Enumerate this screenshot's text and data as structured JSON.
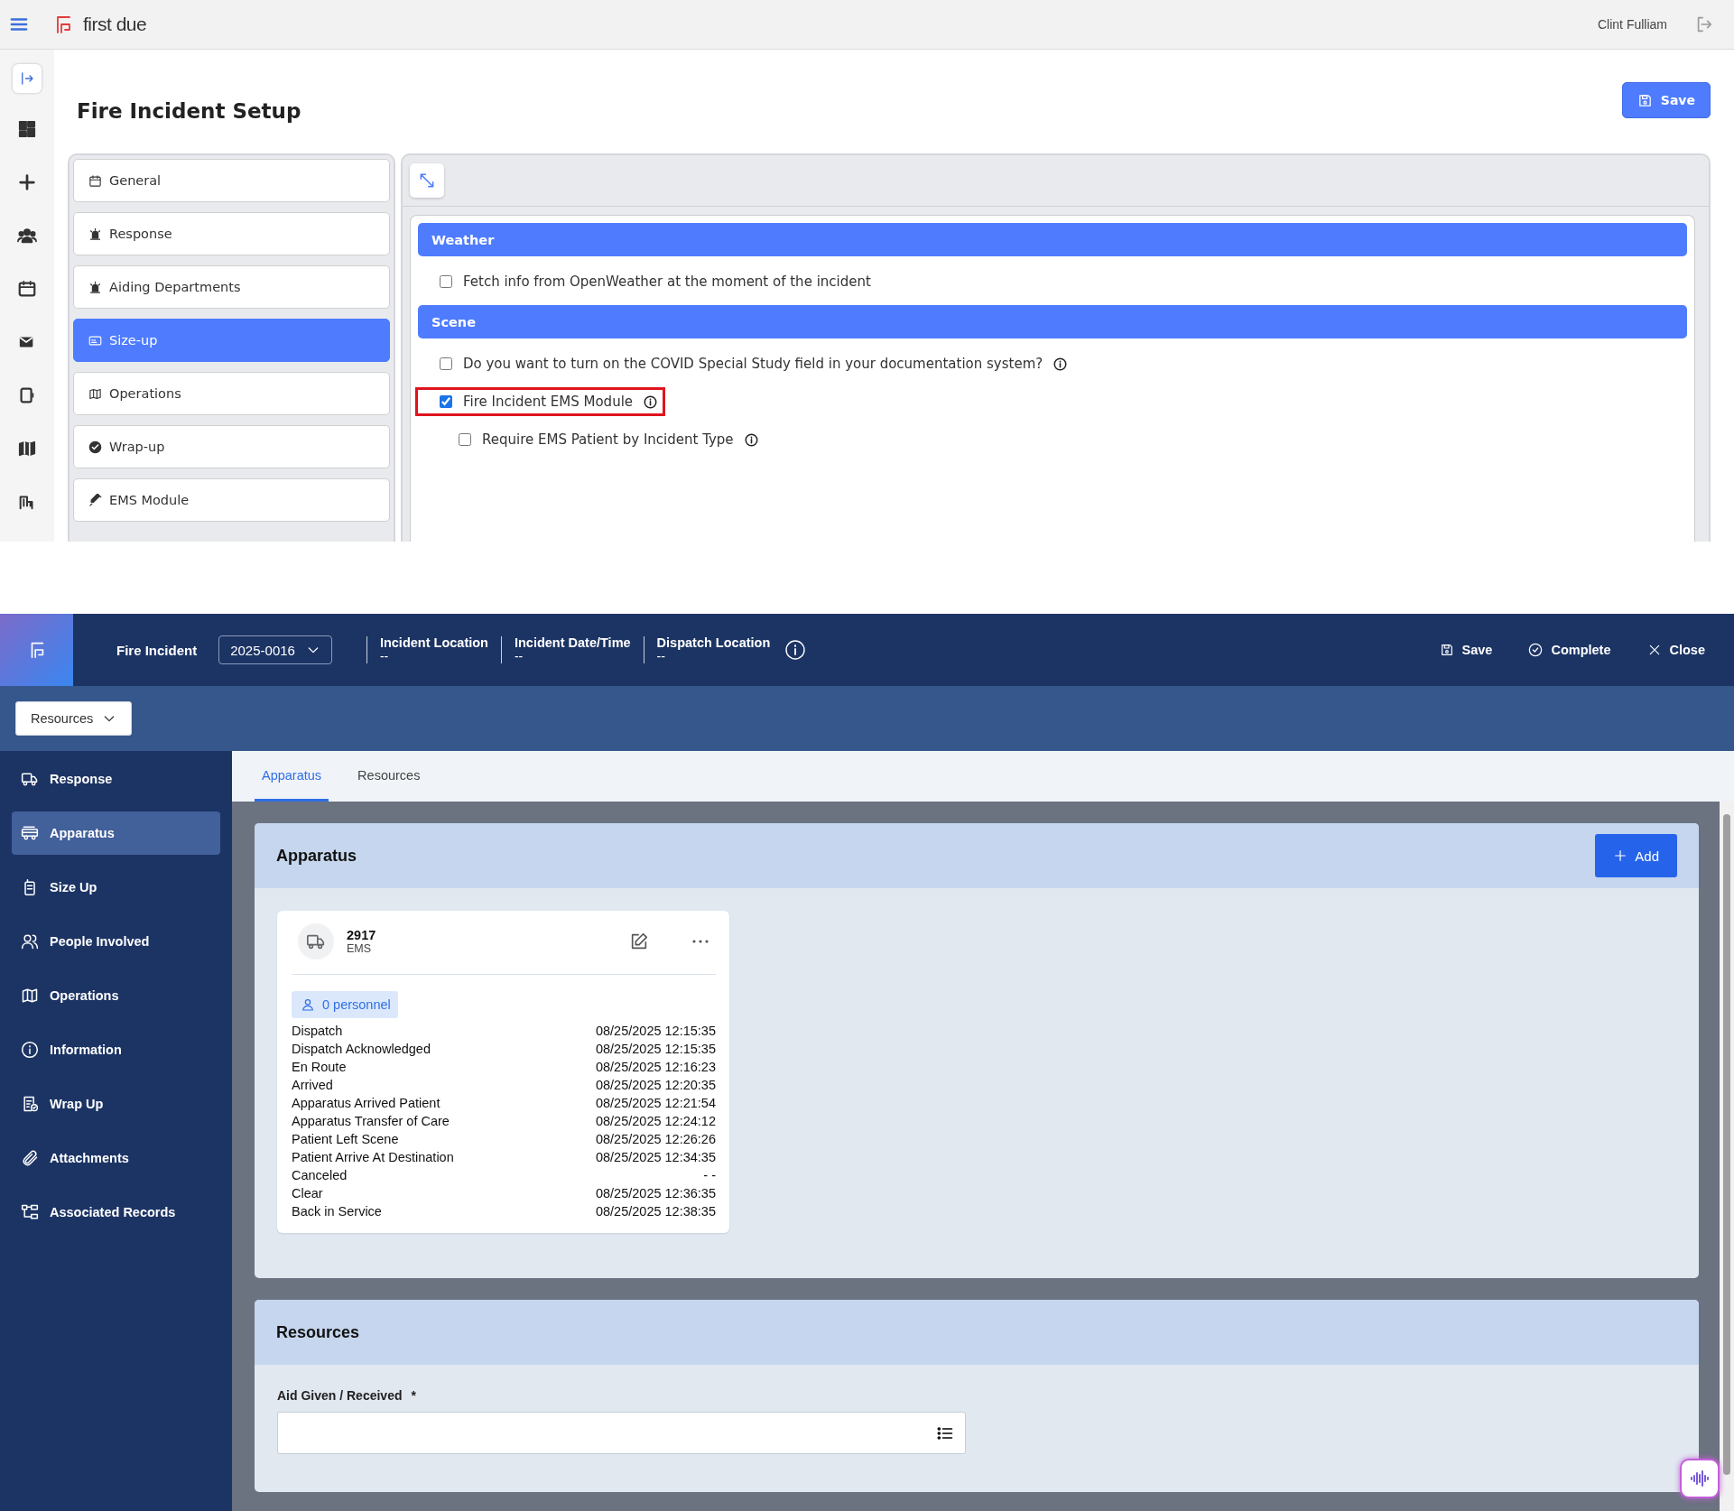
{
  "setup_screen": {
    "app_header": {
      "brand": "first due",
      "user": "Clint Fulliam"
    },
    "title": "Fire Incident Setup",
    "save_button": "Save",
    "menu": [
      {
        "kind": "calendar",
        "label": "General",
        "selected": false
      },
      {
        "kind": "siren",
        "label": "Response",
        "selected": false
      },
      {
        "kind": "siren",
        "label": "Aiding Departments",
        "selected": false
      },
      {
        "kind": "card",
        "label": "Size-up",
        "selected": true
      },
      {
        "kind": "map",
        "label": "Operations",
        "selected": false
      },
      {
        "kind": "check",
        "label": "Wrap-up",
        "selected": false
      },
      {
        "kind": "syringe",
        "label": "EMS Module",
        "selected": false
      }
    ],
    "sections": [
      {
        "title": "Weather",
        "options": [
          {
            "label": "Fetch info from OpenWeather at the moment of the incident",
            "checked": false,
            "info": false,
            "highlighted": false,
            "indented": false
          }
        ]
      },
      {
        "title": "Scene",
        "options": [
          {
            "label": "Do you want to turn on the COVID Special Study field in your documentation system?",
            "checked": false,
            "info": true,
            "highlighted": false,
            "indented": false
          },
          {
            "label": "Fire Incident EMS Module",
            "checked": true,
            "info": true,
            "highlighted": true,
            "indented": false
          },
          {
            "label": "Require EMS Patient by Incident Type",
            "checked": false,
            "info": true,
            "highlighted": false,
            "indented": true
          }
        ]
      }
    ]
  },
  "incident_screen": {
    "header": {
      "form": "Fire Incident",
      "incident_number": "2025-0016",
      "fields": [
        {
          "label": "Incident Location",
          "value": "--"
        },
        {
          "label": "Incident Date/Time",
          "value": "--"
        },
        {
          "label": "Dispatch Location",
          "value": "--"
        }
      ],
      "actions": [
        {
          "kind": "save",
          "label": "Save"
        },
        {
          "kind": "complete",
          "label": "Complete"
        },
        {
          "kind": "close",
          "label": "Close"
        }
      ]
    },
    "section_select": "Resources",
    "sidebar": [
      {
        "kind": "response",
        "label": "Response",
        "selected": false
      },
      {
        "kind": "apparatus",
        "label": "Apparatus",
        "selected": true
      },
      {
        "kind": "size_up",
        "label": "Size Up",
        "selected": false
      },
      {
        "kind": "people",
        "label": "People Involved",
        "selected": false
      },
      {
        "kind": "operations",
        "label": "Operations",
        "selected": false
      },
      {
        "kind": "information",
        "label": "Information",
        "selected": false
      },
      {
        "kind": "wrap_up",
        "label": "Wrap Up",
        "selected": false
      },
      {
        "kind": "attachments",
        "label": "Attachments",
        "selected": false
      },
      {
        "kind": "associated",
        "label": "Associated Records",
        "selected": false
      }
    ],
    "tabs": [
      {
        "label": "Apparatus",
        "selected": true
      },
      {
        "label": "Resources",
        "selected": false
      }
    ],
    "apparatus_panel": {
      "title": "Apparatus",
      "add_button": "Add",
      "cards": [
        {
          "unit": "2917",
          "type": "EMS",
          "personnel": "0 personnel",
          "times": [
            {
              "event": "Dispatch",
              "time": "08/25/2025 12:15:35"
            },
            {
              "event": "Dispatch Acknowledged",
              "time": "08/25/2025 12:15:35"
            },
            {
              "event": "En Route",
              "time": "08/25/2025 12:16:23"
            },
            {
              "event": "Arrived",
              "time": "08/25/2025 12:20:35"
            },
            {
              "event": "Apparatus Arrived Patient",
              "time": "08/25/2025 12:21:54"
            },
            {
              "event": "Apparatus Transfer of Care",
              "time": "08/25/2025 12:24:12"
            },
            {
              "event": "Patient Left Scene",
              "time": "08/25/2025 12:26:26"
            },
            {
              "event": "Patient Arrive At Destination",
              "time": "08/25/2025 12:34:35"
            },
            {
              "event": "Canceled",
              "time": "- -"
            },
            {
              "event": "Clear",
              "time": "08/25/2025 12:36:35"
            },
            {
              "event": "Back in Service",
              "time": "08/25/2025 12:38:35"
            }
          ]
        }
      ]
    },
    "resources_panel": {
      "title": "Resources",
      "field": {
        "label": "Aid Given / Received",
        "required_mark": "*"
      }
    }
  }
}
